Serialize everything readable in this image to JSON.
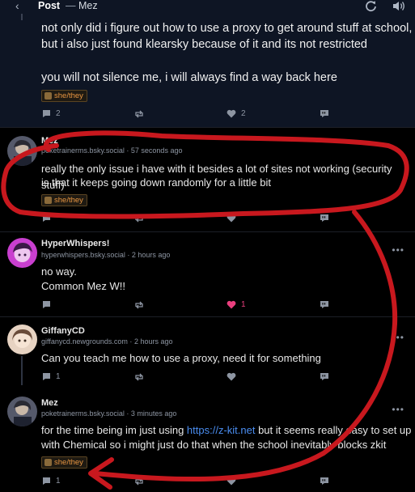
{
  "header": {
    "back_icon": "chevron-left-icon",
    "title": "Post",
    "separator": "—",
    "subtitle": "Mez"
  },
  "top_post": {
    "text_line1": "not only did i figure out how to use a proxy to get around stuff at school,",
    "text_line2": "but i also just found klearsky because of it and its not restricted",
    "text_line3": "you will not silence me, i will always find a way back here",
    "pronouns": "she/they",
    "reply_count": "2",
    "like_count": "2"
  },
  "posts": [
    {
      "name": "Mez",
      "handle": "poketrainerms.bsky.social",
      "time": "57 seconds ago",
      "text_line1": "really the only issue i have with it besides a lot of sites not working (security stuff)",
      "text_line2": "is that it keeps going down randomly for a little bit",
      "pronouns": "she/they"
    },
    {
      "name": "HyperWhispers!",
      "handle": "hyperwhispers.bsky.social",
      "time": "2 hours ago",
      "text_line1": "no way.",
      "text_line2": "Common Mez W!!",
      "like_count": "1"
    },
    {
      "name": "GiffanyCD",
      "handle": "giffanycd.newgrounds.com",
      "time": "2 hours ago",
      "text_line1": "Can you teach me how to use a proxy, need it for something",
      "reply_count": "1"
    },
    {
      "name": "Mez",
      "handle": "poketrainerms.bsky.social",
      "time": "3 minutes ago",
      "text_before_link": "for the time being im just using ",
      "link": "https://z-kit.net",
      "text_after_link": " but it seems really easy to set up",
      "text_line2": "with Chemical so i might just do that when the school inevitably blocks zkit",
      "pronouns": "she/they",
      "reply_count": "1"
    }
  ],
  "time_separator": "·",
  "more_label": "•••",
  "colors": {
    "annotation_red": "#c8181e",
    "like_active": "#ea3f7e",
    "link": "#4a8df0",
    "pronoun_badge": "#e79541"
  }
}
